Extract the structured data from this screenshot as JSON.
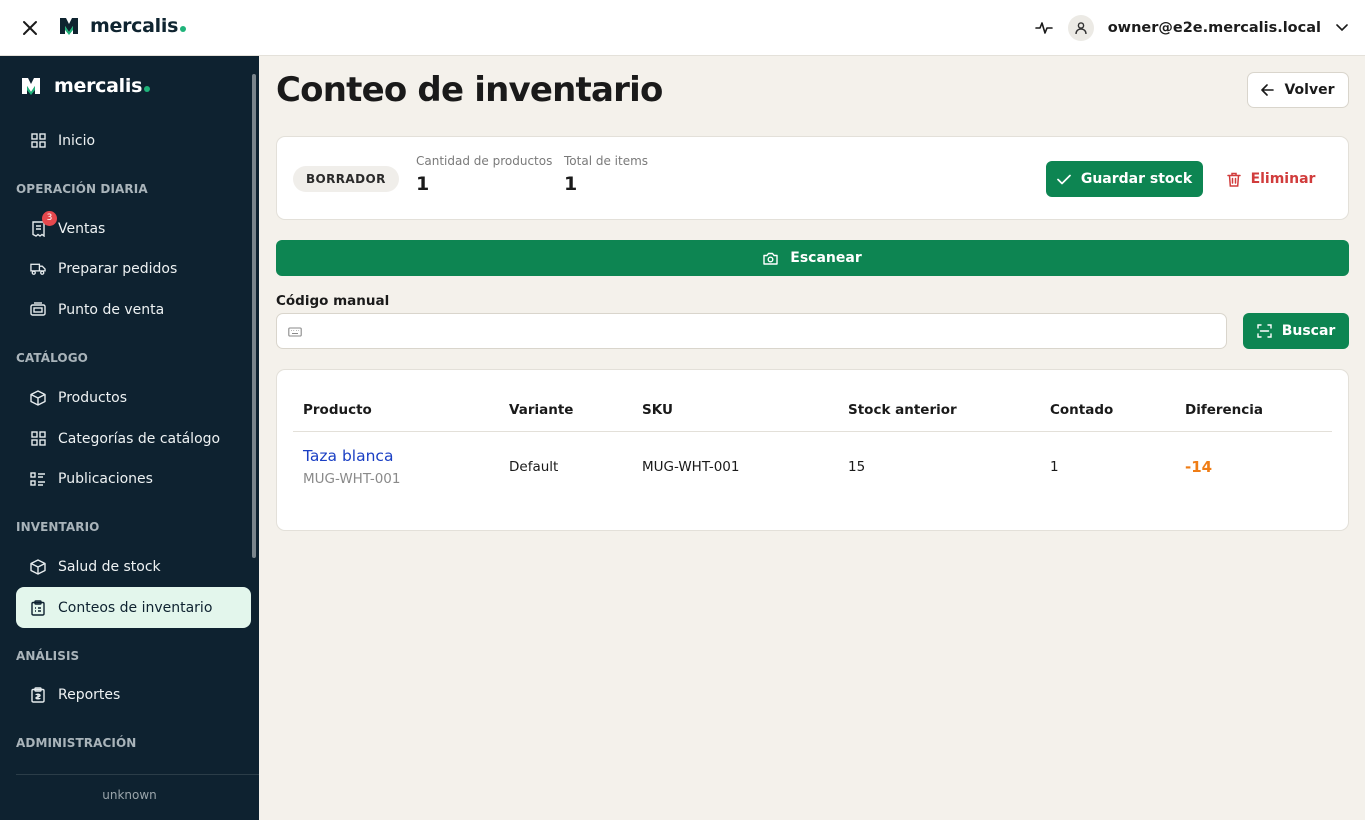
{
  "topbar": {
    "brand": "mercalis",
    "user_email": "owner@e2e.mercalis.local"
  },
  "sidebar": {
    "brand": "mercalis",
    "home": {
      "label": "Inicio",
      "icon": "grid-icon"
    },
    "sections": [
      {
        "title": "OPERACIÓN DIARIA",
        "items": [
          {
            "label": "Ventas",
            "icon": "receipt-icon",
            "badge": "3"
          },
          {
            "label": "Preparar pedidos",
            "icon": "truck-icon"
          },
          {
            "label": "Punto de venta",
            "icon": "register-icon"
          }
        ]
      },
      {
        "title": "CATÁLOGO",
        "items": [
          {
            "label": "Productos",
            "icon": "box-icon"
          },
          {
            "label": "Categorías de catálogo",
            "icon": "grid-icon"
          },
          {
            "label": "Publicaciones",
            "icon": "list-icon"
          }
        ]
      },
      {
        "title": "INVENTARIO",
        "items": [
          {
            "label": "Salud de stock",
            "icon": "box-icon"
          },
          {
            "label": "Conteos de inventario",
            "icon": "clipboard-icon",
            "active": true
          }
        ]
      },
      {
        "title": "ANÁLISIS",
        "items": [
          {
            "label": "Reportes",
            "icon": "report-icon"
          }
        ]
      },
      {
        "title": "ADMINISTRACIÓN",
        "items": []
      }
    ],
    "footer": "unknown"
  },
  "page": {
    "title": "Conteo de inventario",
    "back_label": "Volver"
  },
  "summary": {
    "status": "BORRADOR",
    "products_label": "Cantidad de productos",
    "products_value": "1",
    "items_label": "Total de items",
    "items_value": "1",
    "save_label": "Guardar stock",
    "delete_label": "Eliminar"
  },
  "scan": {
    "label": "Escanear"
  },
  "manual": {
    "label": "Código manual",
    "value": "",
    "placeholder": "",
    "search_label": "Buscar"
  },
  "table": {
    "headers": [
      "Producto",
      "Variante",
      "SKU",
      "Stock anterior",
      "Contado",
      "Diferencia"
    ],
    "rows": [
      {
        "product": "Taza blanca",
        "product_sku": "MUG-WHT-001",
        "variant": "Default",
        "sku": "MUG-WHT-001",
        "previous_stock": "15",
        "counted": "1",
        "difference": "-14"
      }
    ]
  },
  "colors": {
    "primary": "#0d8552",
    "sidebar": "#0e2230",
    "danger": "#d13c3c",
    "warning": "#ef7d16",
    "link": "#1a3fc4"
  }
}
